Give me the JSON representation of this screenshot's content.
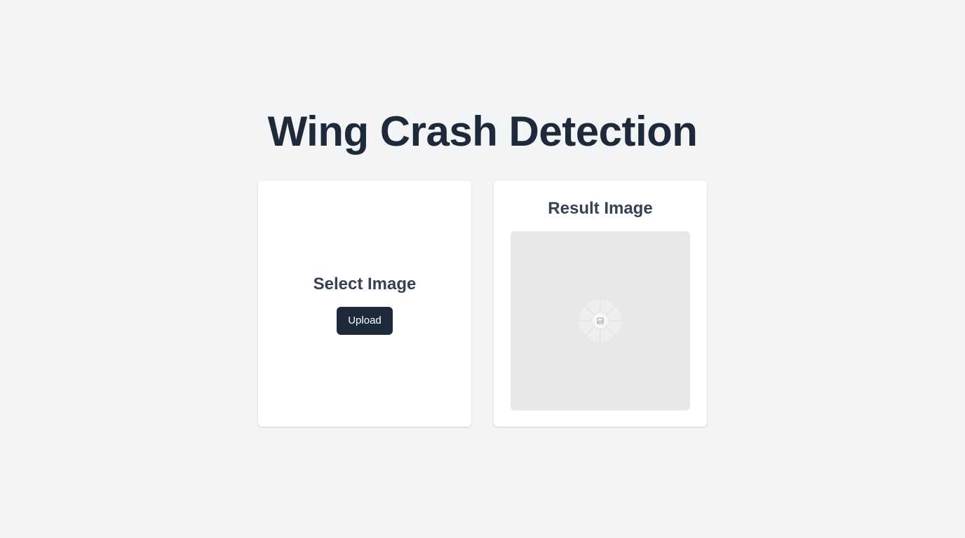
{
  "page": {
    "title": "Wing Crash Detection"
  },
  "upload_card": {
    "heading": "Select Image",
    "upload_label": "Upload"
  },
  "result_card": {
    "heading": "Result Image",
    "placeholder_icon": "broken-image-icon"
  },
  "colors": {
    "background": "#f2f4f6",
    "card": "#ffffff",
    "title_text": "#1e2939",
    "heading_text": "#364153",
    "button_bg": "#1e2939",
    "button_text": "#ffffff",
    "image_placeholder_bg": "#e8e8e8"
  }
}
